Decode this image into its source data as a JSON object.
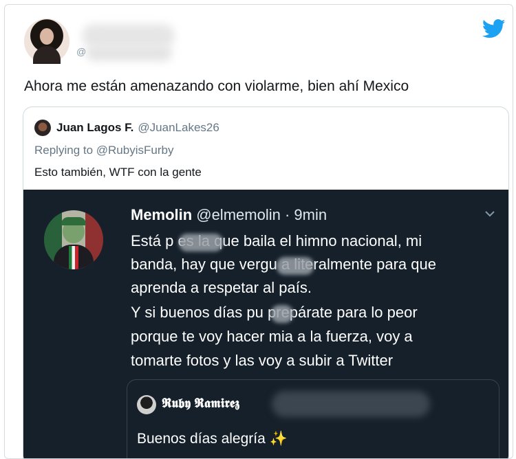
{
  "tweet": {
    "handle_prefix": "@",
    "text": "Ahora me están amenazando con violarme, bien ahí Mexico",
    "brand_color": "#1da1f2"
  },
  "quoted": {
    "name": "Juan Lagos F.",
    "handle": "@JuanLakes26",
    "replying": "Replying to @RubyisFurby",
    "text": "Esto también, WTF con la gente"
  },
  "embedded": {
    "name": "Memolin",
    "handle": "@elmemolin",
    "time": "· 9min",
    "lines": [
      "Está p         es la que baila el himno nacional, mi",
      "banda, hay que vergu         a literalmente para que",
      "aprenda a respetar al país.",
      "Y si buenos días pu      prepárate para lo peor",
      "porque te voy hacer mia a la fuerza, voy a",
      "tomarte fotos y las voy a subir a Twitter"
    ],
    "inner": {
      "name": "𝕽𝖚𝖇𝖞 𝕽𝖆𝖒𝖎𝖗𝖊𝖟",
      "handle_prefix": "@",
      "text": "Buenos días alegría",
      "emoji": "✨"
    }
  },
  "icons": {
    "bird": "twitter-bird-icon",
    "chevron": "chevron-down-icon"
  }
}
